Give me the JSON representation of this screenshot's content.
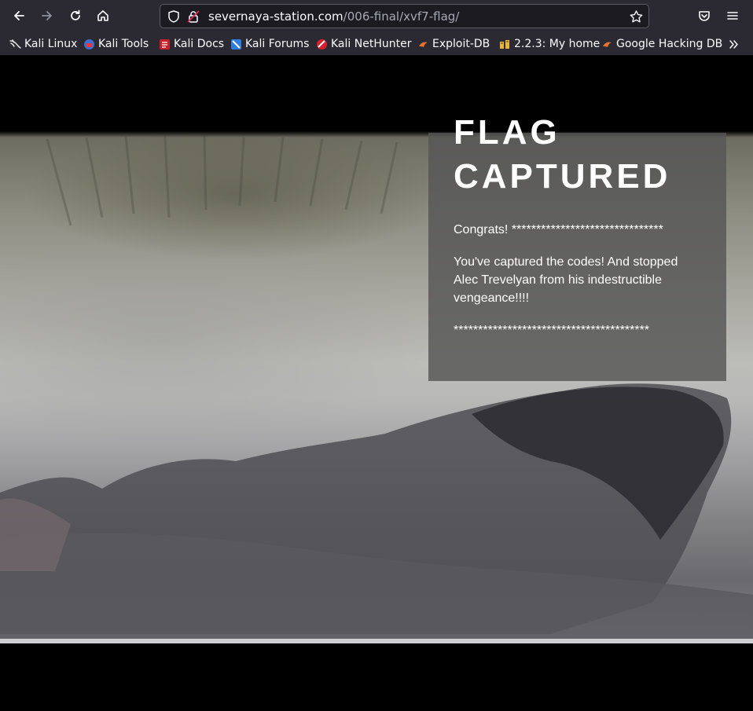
{
  "browser": {
    "url_host": "severnaya-station.com",
    "url_path": "/006-final/xvf7-flag/",
    "bookmarks": [
      {
        "label": "Kali Linux",
        "icon": "kali-dragon-icon"
      },
      {
        "label": "Kali Tools",
        "icon": "kali-tools-icon"
      },
      {
        "label": "Kali Docs",
        "icon": "kali-docs-icon"
      },
      {
        "label": "Kali Forums",
        "icon": "kali-forums-icon"
      },
      {
        "label": "Kali NetHunter",
        "icon": "kali-nethunter-icon"
      },
      {
        "label": "Exploit-DB",
        "icon": "exploit-db-icon"
      },
      {
        "label": "2.2.3: My home",
        "icon": "home-page-icon"
      },
      {
        "label": "Google Hacking DB",
        "icon": "ghdb-icon"
      }
    ]
  },
  "page": {
    "title_line1": "FLAG",
    "title_line2": "CAPTURED",
    "congrats": "Congrats! *******************************",
    "message": "You've captured the codes! And stopped Alec Trevelyan from his indestructible vengeance!!!!",
    "stars": "****************************************"
  },
  "colors": {
    "toolbar": "#2b2a33",
    "urlbar": "#1c1b22",
    "card": "#555555",
    "page_bg": "#000000"
  }
}
